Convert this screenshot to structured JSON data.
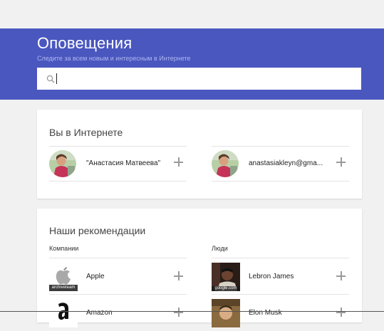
{
  "header": {
    "title": "Оповещения",
    "subtitle": "Следите за всем новым и интересным в Интернете",
    "search": {
      "value": "",
      "placeholder": ""
    },
    "color": "#4a57bf"
  },
  "you_online": {
    "title": "Вы в Интернете",
    "items": [
      {
        "label": "\"Анастасия Матвеева\"",
        "icon": "user-avatar"
      },
      {
        "label": "anastasiakleyn@gma...",
        "icon": "user-avatar"
      }
    ]
  },
  "recommendations": {
    "title": "Наши рекомендации",
    "companies": {
      "heading": "Компании",
      "items": [
        {
          "label": "Apple",
          "logo_caption": "archiveteam"
        },
        {
          "label": "Amazon",
          "logo_caption": ""
        }
      ]
    },
    "people": {
      "heading": "Люди",
      "items": [
        {
          "label": "Lebron James",
          "logo_caption": "google.com"
        },
        {
          "label": "Elon Musk",
          "logo_caption": ""
        }
      ]
    }
  }
}
